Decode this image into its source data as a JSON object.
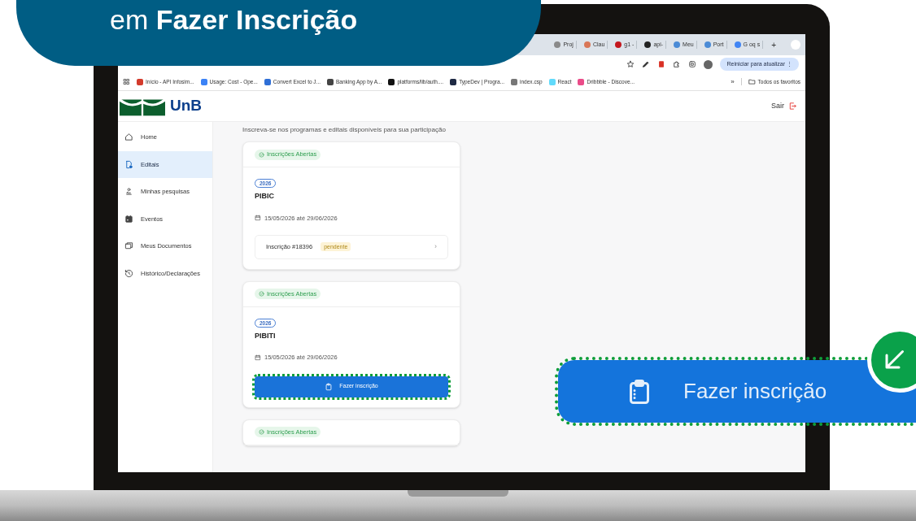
{
  "banner": {
    "text": "em **Fazer Inscrição**"
  },
  "browser": {
    "tabs": [
      {
        "label": "Proj",
        "color": "#8a8a8a"
      },
      {
        "label": "Clau",
        "color": "#d97757"
      },
      {
        "label": "g1 -",
        "color": "#c4171d"
      },
      {
        "label": "api-",
        "color": "#222222"
      },
      {
        "label": "Meu",
        "color": "#4b8bd6"
      },
      {
        "label": "Port",
        "color": "#4b8bd6"
      },
      {
        "label": "G oq s",
        "color": "#4285f4"
      }
    ],
    "new_tab": "+",
    "restart_button": "Reiniciar para atualizar ⋮",
    "bookmarks": [
      {
        "label": "Início - API Infosim...",
        "color": "#d33b2c"
      },
      {
        "label": "Usage: Cost - Ope...",
        "color": "#3b82f6"
      },
      {
        "label": "Convert Excel to J...",
        "color": "#2f6fd6"
      },
      {
        "label": "Banking App by A...",
        "color": "#444444"
      },
      {
        "label": "platforms/lib/auth....",
        "color": "#111111"
      },
      {
        "label": "TypeDev | Progra...",
        "color": "#1e2a44"
      },
      {
        "label": "index.csp",
        "color": "#777777"
      },
      {
        "label": "React",
        "color": "#61dafb"
      },
      {
        "label": "Dribbble - Discove...",
        "color": "#ea4c89"
      }
    ],
    "more": "»",
    "all_bookmarks": "Todos os favoritos"
  },
  "app": {
    "logo": "UnB",
    "logout": "Sair",
    "sidebar": [
      {
        "label": "Home",
        "selected": false
      },
      {
        "label": "Editais",
        "selected": true
      },
      {
        "label": "Minhas pesquisas",
        "selected": false
      },
      {
        "label": "Eventos",
        "selected": false
      },
      {
        "label": "Meus Documentos",
        "selected": false
      },
      {
        "label": "Histórico/Declarações",
        "selected": false
      }
    ],
    "subtitle": "Inscreva-se nos programas e editais disponíveis para sua participação",
    "cards": [
      {
        "kind": "inscription",
        "status": "Inscrições Abertas",
        "year": "2026",
        "title": "PIBIC",
        "dates": "15/05/2026 até 29/06/2026",
        "inscription": "Inscrição #18396",
        "badge": "pendente",
        "chevron": "›"
      },
      {
        "kind": "button",
        "status": "Inscrições Abertas",
        "year": "2026",
        "title": "PIBITI",
        "dates": "15/05/2026 até 29/06/2026",
        "button": "Fazer inscrição"
      },
      {
        "kind": "partial",
        "status": "Inscrições Abertas"
      }
    ]
  },
  "callout": {
    "label": "Fazer inscrição"
  }
}
